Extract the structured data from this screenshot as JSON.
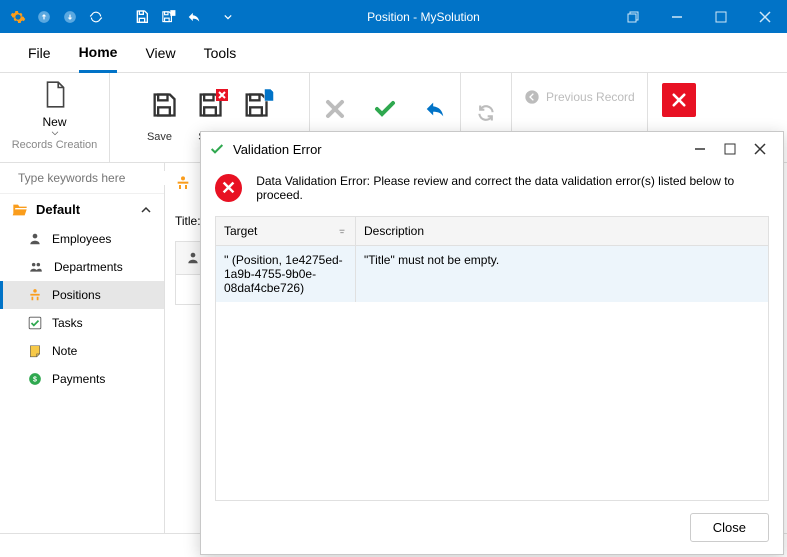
{
  "titlebar": {
    "title": "Position - MySolution"
  },
  "menu": {
    "file": "File",
    "home": "Home",
    "view": "View",
    "tools": "Tools"
  },
  "ribbon": {
    "new": "New",
    "records_creation": "Records Creation",
    "save": "Save",
    "save_close": "Save & Close",
    "save_close_visible": "Sav\nCl",
    "previous": "Previous Record"
  },
  "sidebar": {
    "search_placeholder": "Type keywords here",
    "folder": "Default",
    "items": [
      "Employees",
      "Departments",
      "Positions",
      "Tasks",
      "Note",
      "Payments"
    ]
  },
  "main": {
    "title_label": "Title:*"
  },
  "dialog": {
    "title": "Validation Error",
    "message": "Data Validation Error: Please review and correct the data validation error(s) listed below to proceed.",
    "columns": [
      "Target",
      "Description"
    ],
    "row": {
      "target": "'' (Position, 1e4275ed-1a9b-4755-9b0e-08daf4cbe726)",
      "description": "\"Title\" must not be empty."
    },
    "close": "Close"
  }
}
